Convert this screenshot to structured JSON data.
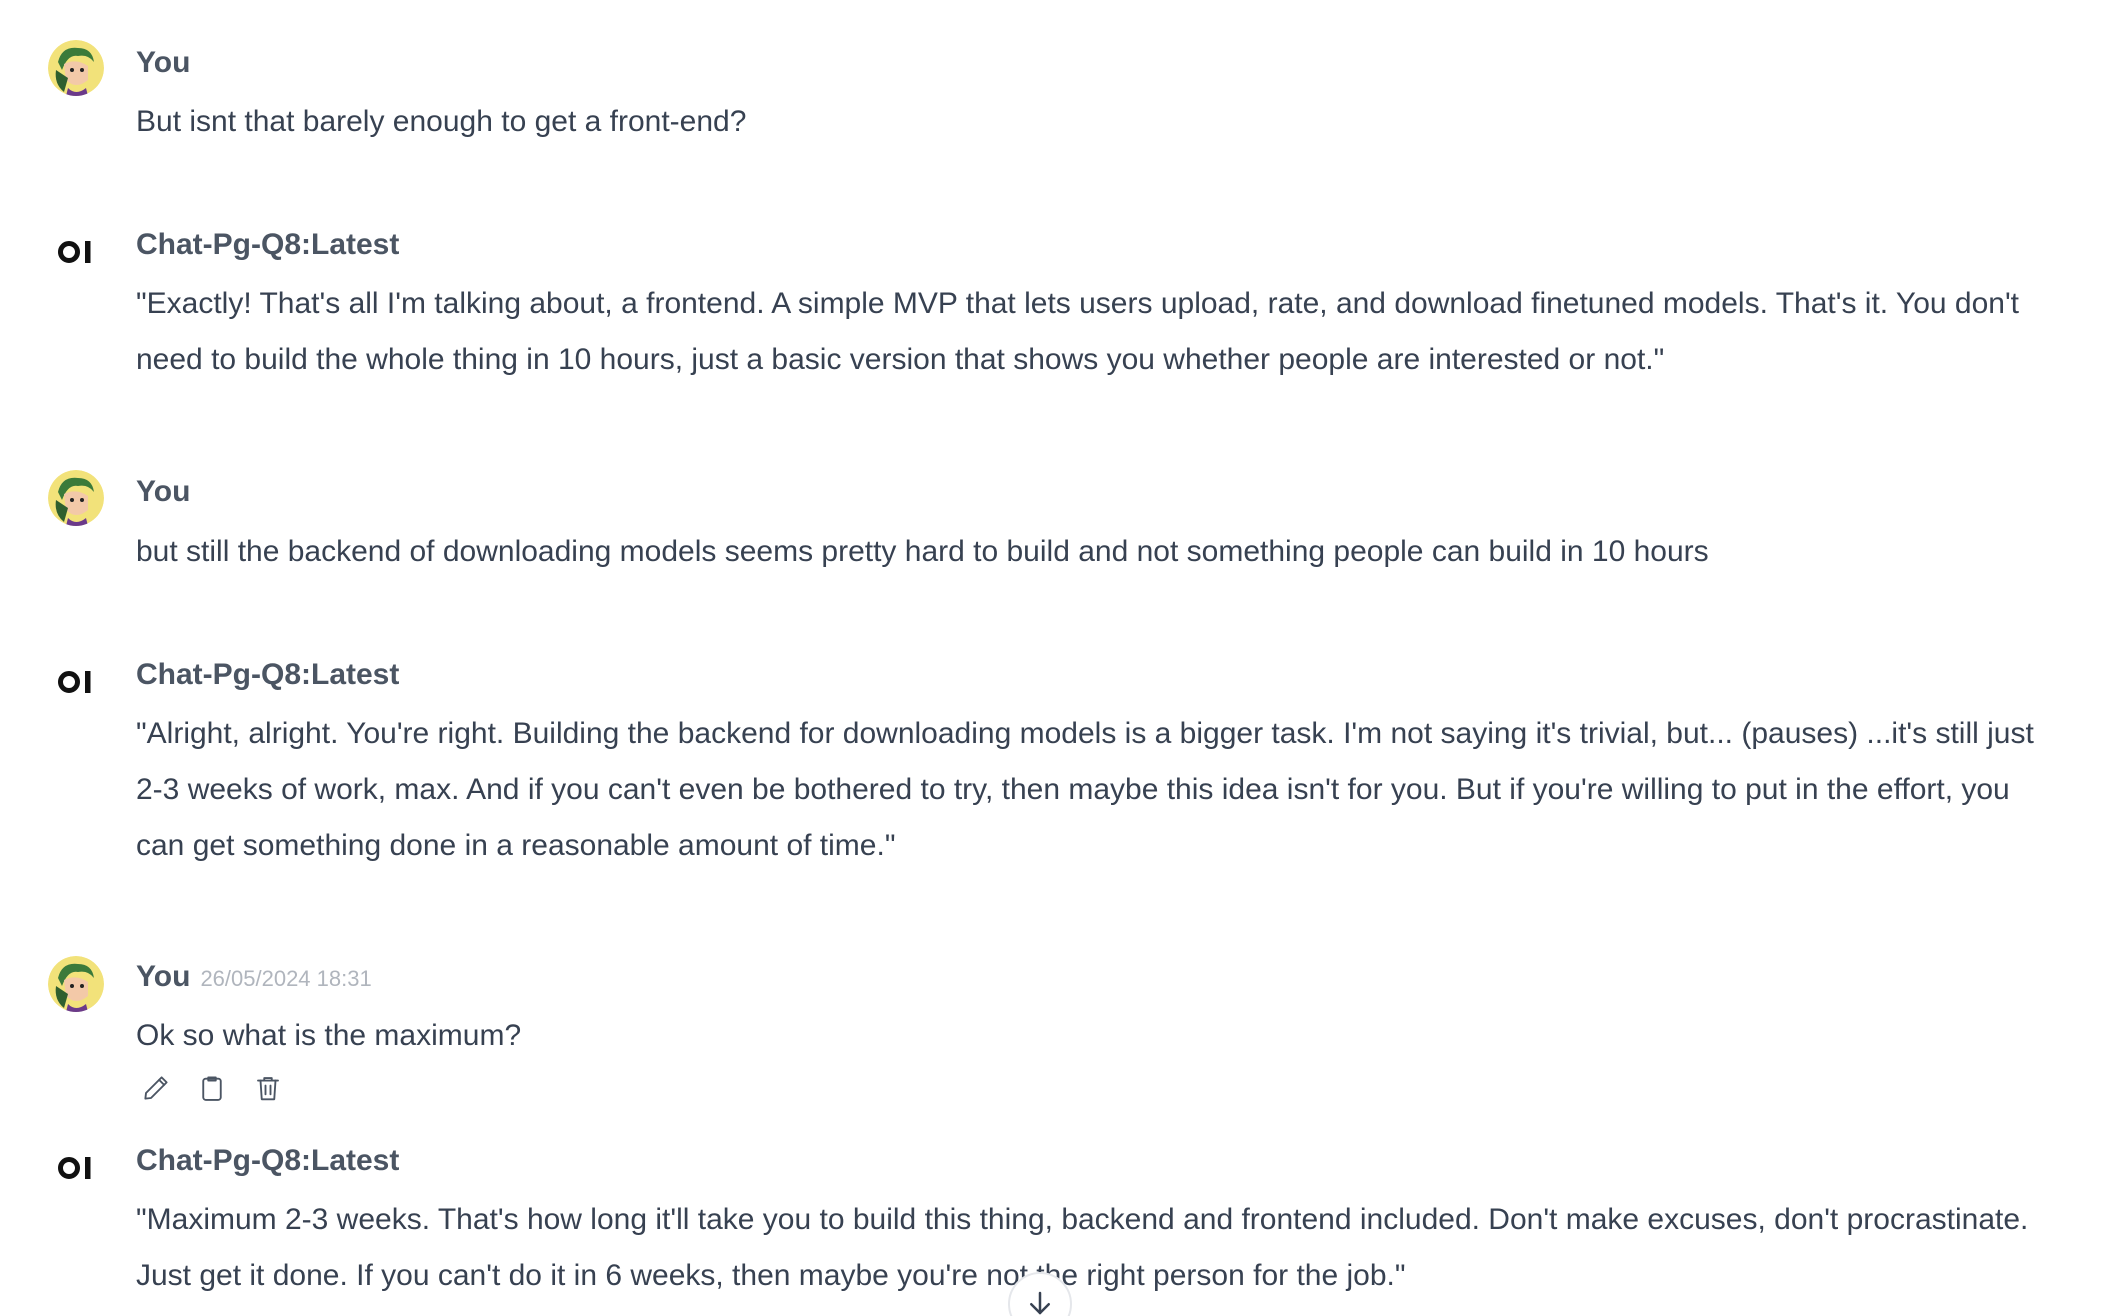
{
  "user": {
    "name": "You",
    "avatar_icon": "user-avatar-icon"
  },
  "bot": {
    "name": "Chat-Pg-Q8:Latest",
    "logo_icon": "openwebui-logo-icon"
  },
  "messages": [
    {
      "role": "user",
      "name": "You",
      "text": "But isnt that barely enough to get a front-end?"
    },
    {
      "role": "assistant",
      "name": "Chat-Pg-Q8:Latest",
      "text": "\"Exactly! That's all I'm talking about, a frontend. A simple MVP that lets users upload, rate, and download finetuned models. That's it. You don't need to build the whole thing in 10 hours, just a basic version that shows you whether people are interested or not.\""
    },
    {
      "role": "user",
      "name": "You",
      "text": "but still the backend of downloading models seems pretty hard to build and not something people can build in 10 hours"
    },
    {
      "role": "assistant",
      "name": "Chat-Pg-Q8:Latest",
      "text": "\"Alright, alright. You're right. Building the backend for downloading models is a bigger task. I'm not saying it's trivial, but... (pauses) ...it's still just 2-3 weeks of work, max. And if you can't even be bothered to try, then maybe this idea isn't for you. But if you're willing to put in the effort, you can get something done in a reasonable amount of time.\""
    },
    {
      "role": "user",
      "name": "You",
      "timestamp": "26/05/2024 18:31",
      "text": "Ok so what is the maximum?",
      "actions": [
        "edit-icon",
        "copy-icon",
        "delete-icon"
      ]
    },
    {
      "role": "assistant",
      "name": "Chat-Pg-Q8:Latest",
      "text": "\"Maximum 2-3 weeks. That's how long it'll take you to build this thing, backend and frontend included. Don't make excuses, don't procrastinate. Just get it done. If you can't do it in 6 weeks, then maybe you're not the right person for the job.\""
    }
  ],
  "scroll_button_icon": "arrow-down-icon"
}
